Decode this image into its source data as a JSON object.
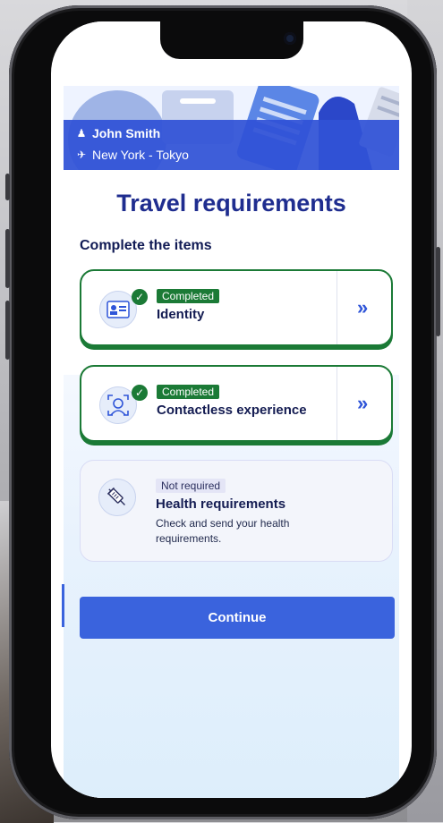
{
  "header": {
    "passenger_name": "John Smith",
    "route": "New York - Tokyo",
    "user_icon": "person-icon",
    "plane_icon": "airplane-icon"
  },
  "page": {
    "title": "Travel requirements",
    "subtitle": "Complete the items"
  },
  "items": [
    {
      "status": "Completed",
      "title": "Identity",
      "icon": "id-card-icon"
    },
    {
      "status": "Completed",
      "title": "Contactless experience",
      "icon": "face-scan-icon"
    },
    {
      "status": "Not required",
      "title": "Health requirements",
      "description": "Check and send your health requirements.",
      "icon": "syringe-icon"
    }
  ],
  "actions": {
    "continue_label": "Continue"
  },
  "colors": {
    "primary": "#3a63dd",
    "title": "#1f2d8f",
    "success": "#1b7a36",
    "banner": "#3052d6"
  }
}
